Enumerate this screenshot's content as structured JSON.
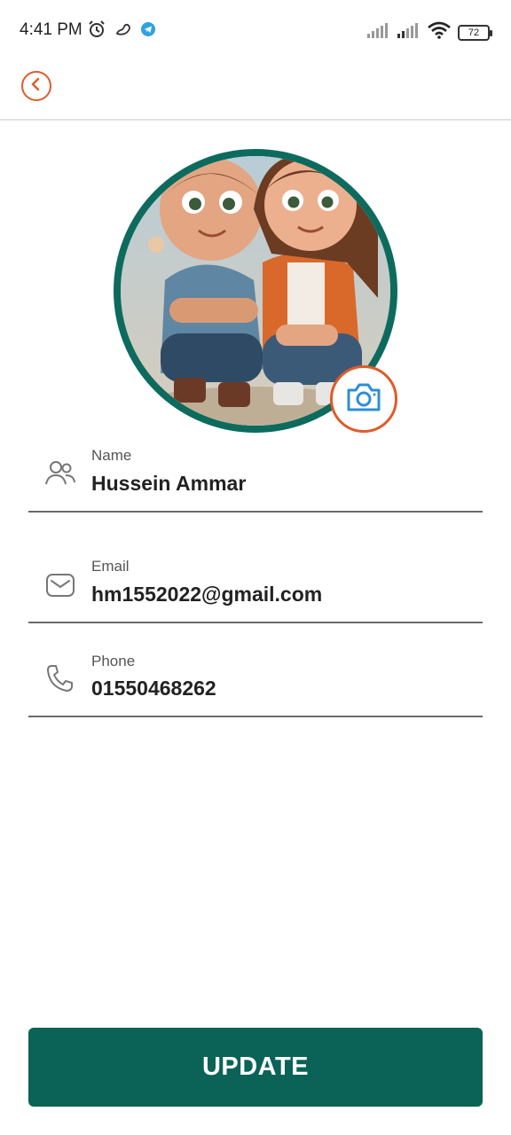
{
  "status_bar": {
    "time": "4:41 PM",
    "battery": "72",
    "icons": [
      "alarm-icon",
      "app-notification-icon",
      "telegram-icon",
      "signal-icon",
      "signal-icon",
      "wifi-icon",
      "battery-icon"
    ]
  },
  "header": {
    "back_icon": "chevron-left-icon"
  },
  "profile": {
    "avatar_icon": "avatar-illustration",
    "camera_icon": "camera-icon"
  },
  "fields": [
    {
      "label": "Name",
      "value": "Hussein Ammar",
      "icon": "users-icon"
    },
    {
      "label": "Email",
      "value": "hm1552022@gmail.com",
      "icon": "mail-icon"
    },
    {
      "label": "Phone",
      "value": "01550468262",
      "icon": "phone-icon"
    }
  ],
  "actions": {
    "update_label": "UPDATE"
  },
  "colors": {
    "primary": "#0b6357",
    "ring": "#0d6b5d",
    "accent": "#e05a2a",
    "camera_icon": "#2d8fd6"
  }
}
